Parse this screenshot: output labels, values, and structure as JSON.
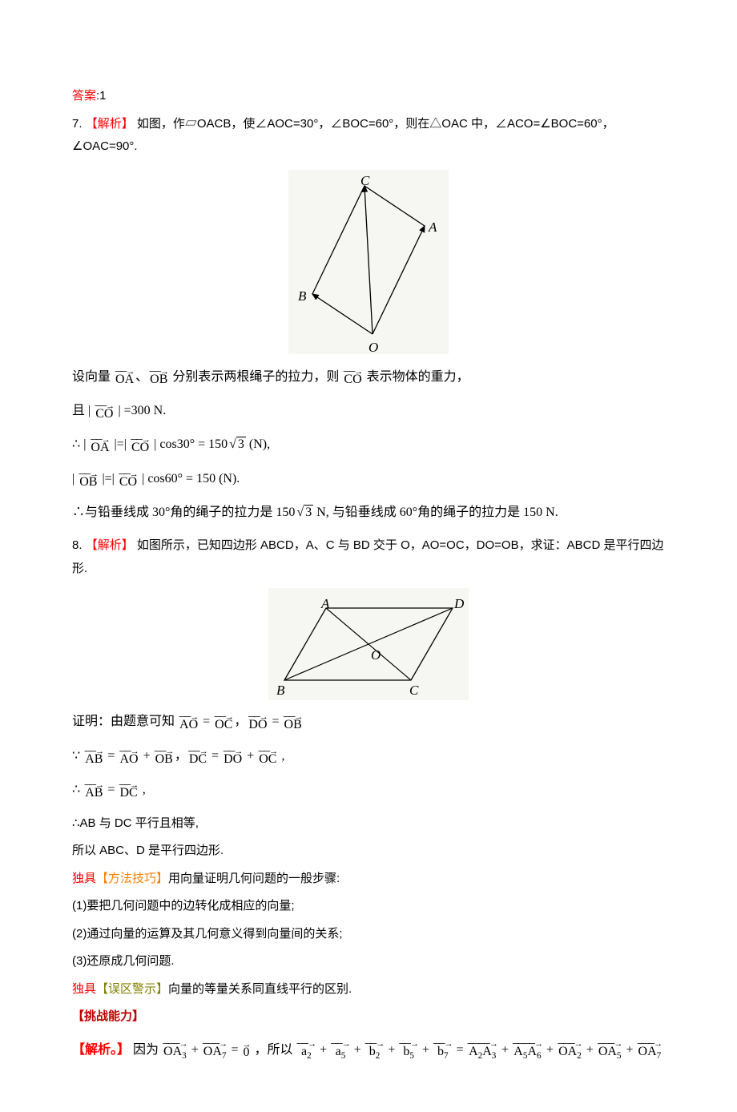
{
  "answer_label_prefix": "答案",
  "answer_label_value": ":1",
  "q7": {
    "analysis_prefix": "7.",
    "analysis_tag": "【解析】",
    "analysis_text": "如图，作▱OACB，使∠AOC=30°，∠BOC=60°，则在△OAC 中，∠ACO=∠BOC=60°，∠OAC=90°.",
    "fig_labels": {
      "A": "A",
      "B": "B",
      "C": "C",
      "O": "O"
    },
    "step_vec_intro_a": "设向量",
    "vec_OA": "OA",
    "sep_dot": "、",
    "vec_OB": "OB",
    "step_vec_intro_b": " 分别表示两根绳子的拉力，则",
    "vec_CO": "CO",
    "step_vec_intro_c": " 表示物体的重力，",
    "step_mag_a": "且 | ",
    "step_mag_b": " | =300  N.",
    "therefore": "∴",
    "eq1_lhs_a": "| ",
    "eq1_lhs_b": " |=| ",
    "eq1_rhs": " | cos30° = 150",
    "sqrt3": "3",
    "eq1_unit": " (N),",
    "eq2_lhs_a": "| ",
    "eq2_lhs_b": " |=| ",
    "eq2_rhs": " | cos60° = 150 (N).",
    "conclusion_a": "∴与铅垂线成 30°角的绳子的拉力是 150",
    "conclusion_b": "  N, 与铅垂线成 60°角的绳子的拉力是 150  N."
  },
  "q8": {
    "analysis_prefix": "8.",
    "analysis_tag": "【解析】",
    "analysis_text": "如图所示，已知四边形 ABCD，A、C 与 BD 交于 O，AO=OC，DO=OB，求证：ABCD 是平行四边形.",
    "fig_labels": {
      "A": "A",
      "B": "B",
      "C": "C",
      "D": "D",
      "O": "O"
    },
    "proof_intro": "证明：由题意可知",
    "vec_AO": "AO",
    "vec_OC": "OC",
    "vec_DO": "DO",
    "vec_OB": "OB",
    "vec_AB": "AB",
    "vec_DC": "DC",
    "eq_symbol": " = ",
    "comma": "，",
    "plus": " + ",
    "because": "∵",
    "conclusion1": "∴AB 与 DC 平行且相等,",
    "conclusion2": "所以 ABC、D 是平行四边形.",
    "tip_tag_prefix": "独具",
    "tip_tag": "【方法技巧】",
    "tip_text": "用向量证明几何问题的一般步骤:",
    "tip1": "(1)要把几何问题中的边转化成相应的向量;",
    "tip2": "(2)通过向量的运算及其几何意义得到向量间的关系;",
    "tip3": "(3)还原成几何问题.",
    "warn_tag_prefix": "独具",
    "warn_tag": "【误区警示】",
    "warn_text": "向量的等量关系同直线平行的区别.",
    "challenge_tag": "【挑战能力】",
    "challenge_analysis_tag": "【解析。】",
    "challenge_text_a": "因为",
    "vec_OA3": "OA",
    "sub3": "3",
    "vec_OA7": "OA",
    "sub7": "7",
    "vec_zero": "0",
    "challenge_text_b": "，所以",
    "vec_a2": "a",
    "sub_a2": "2",
    "vec_a5": "a",
    "sub_a5": "5",
    "vec_b2": "b",
    "sub_b2": "2",
    "vec_b5": "b",
    "sub_b5": "5",
    "vec_b7": "b",
    "sub_b7": "7",
    "vec_A2A3": "A",
    "sub_A2A3a": "2",
    "sub_A2A3b": "3",
    "vec_A5A6": "A",
    "sub_A5A6a": "5",
    "sub_A5A6b": "6",
    "vec_OA2": "OA",
    "sub_OA2": "2",
    "vec_OA5": "OA",
    "sub_OA5": "5"
  }
}
